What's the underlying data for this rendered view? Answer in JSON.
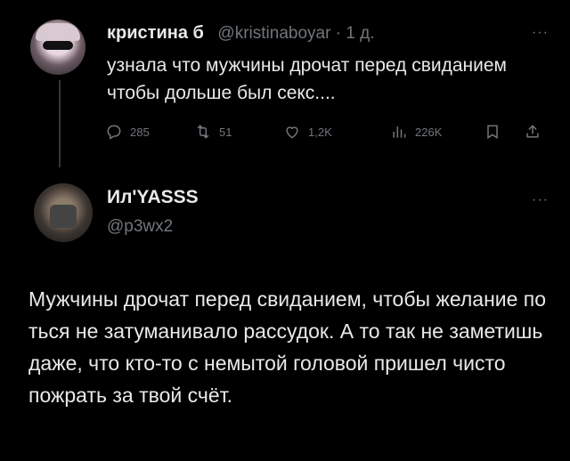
{
  "tweet1": {
    "author_name": "кристина б",
    "author_handle": "@kristinaboyar · 1 д.",
    "more": "···",
    "text": "узнала что мужчины дрочат перед свиданием чтобы дольше был секс....",
    "replies": "285",
    "retweets": "51",
    "likes": "1,2K",
    "views": "226K"
  },
  "tweet2": {
    "author_name": "Ил'YASSS",
    "author_handle": "@p3wx2",
    "more": "···",
    "text": "Мужчины дрочат перед свиданием, чтобы желание по    ться не затуманивало рассудок. А то так не заметишь даже, что кто-то с немытой головой пришел чисто пожрать за твой счёт."
  },
  "icons": [
    "reply-icon",
    "retweet-icon",
    "like-icon",
    "views-icon",
    "bookmark-icon",
    "share-icon"
  ]
}
